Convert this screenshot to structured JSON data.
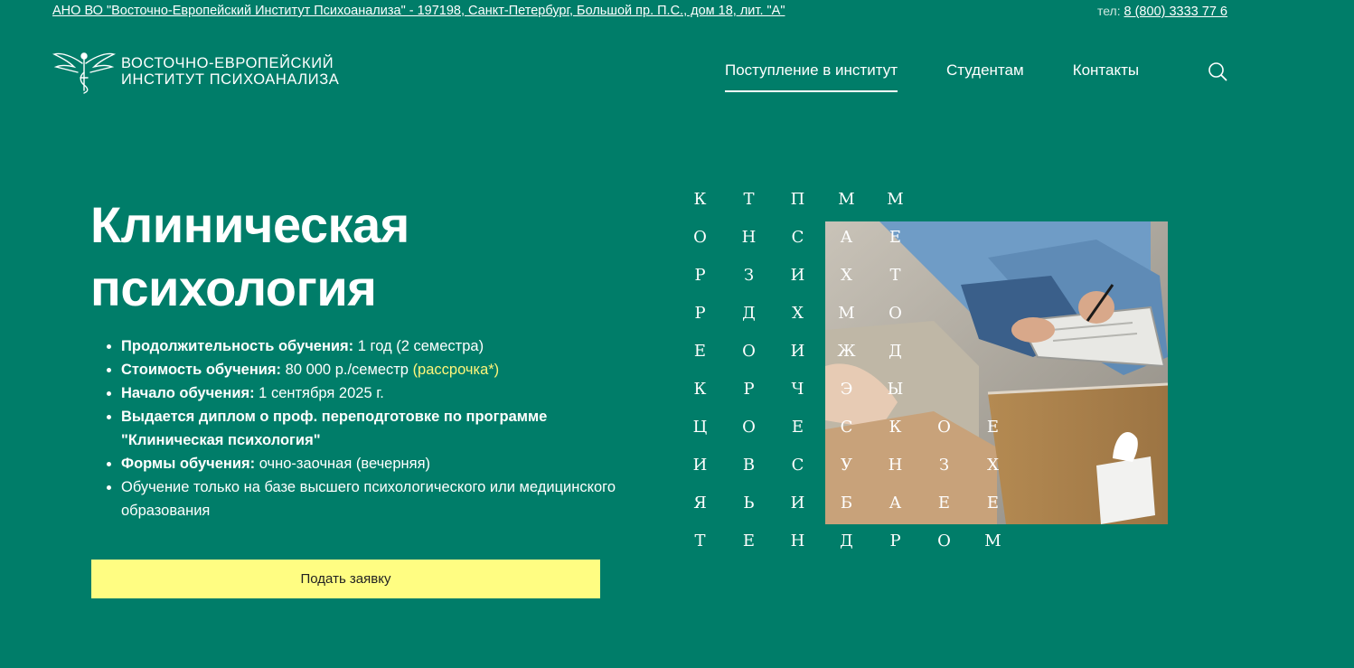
{
  "topbar": {
    "address": "АНО ВО \"Восточно-Европейский Институт Психоанализа\" - 197198, Санкт-Петербург, Большой пр. П.С., дом 18, лит. \"А\"",
    "phone_label": "тел:",
    "phone": "8 (800) 3333 77 6"
  },
  "logo": {
    "line1": "ВОСТОЧНО-ЕВРОПЕЙСКИЙ",
    "line2": "ИНСТИТУТ ПСИХОАНАЛИЗА",
    "icon": "winged-figure-logo"
  },
  "nav": {
    "items": [
      {
        "label": "Поступление в институт",
        "active": true
      },
      {
        "label": "Студентам",
        "active": false
      },
      {
        "label": "Контакты",
        "active": false
      }
    ],
    "search_icon": "search-icon"
  },
  "hero": {
    "title_line1": "Клиническая",
    "title_line2": "психология",
    "facts": [
      {
        "label": "Продолжительность обучения:",
        "value": " 1 год (2 семестра)"
      },
      {
        "label": "Стоимость обучения:",
        "value": " 80 000 р./семестр ",
        "link": "(рассрочка*)"
      },
      {
        "label": "Начало обучения:",
        "value": " 1 сентября 2025 г."
      },
      {
        "label": "Выдается диплом о проф. переподготовке по программе \"Клиническая психология\"",
        "value": ""
      },
      {
        "label": "Формы обучения:",
        "value": " очно-заочная (вечерняя)"
      },
      {
        "label": "",
        "value": "Обучение только на базе высшего психологического или медицинского образования"
      }
    ],
    "cta_label": "Подать заявку"
  },
  "letter_grid": {
    "rows": [
      [
        "К",
        "Т",
        "П",
        "М",
        "М",
        "",
        ""
      ],
      [
        "О",
        "Н",
        "С",
        "А",
        "Е",
        "",
        ""
      ],
      [
        "Р",
        "З",
        "И",
        "Х",
        "Т",
        "",
        ""
      ],
      [
        "Р",
        "Д",
        "Х",
        "М",
        "О",
        "",
        ""
      ],
      [
        "Е",
        "О",
        "И",
        "Ж",
        "Д",
        "",
        ""
      ],
      [
        "К",
        "Р",
        "Ч",
        "Э",
        "Ы",
        "",
        ""
      ],
      [
        "Ц",
        "О",
        "Е",
        "С",
        "К",
        "О",
        "Е"
      ],
      [
        "И",
        "В",
        "С",
        "У",
        "Н",
        "З",
        "Х"
      ],
      [
        "Я",
        "Ь",
        "И",
        "Б",
        "А",
        "Е",
        "Е"
      ],
      [
        "Т",
        "Е",
        "Н",
        "Д",
        "Р",
        "О",
        "М"
      ]
    ]
  },
  "colors": {
    "background": "#007d69",
    "cta": "#fffd82",
    "link_accent": "#fff67a"
  }
}
